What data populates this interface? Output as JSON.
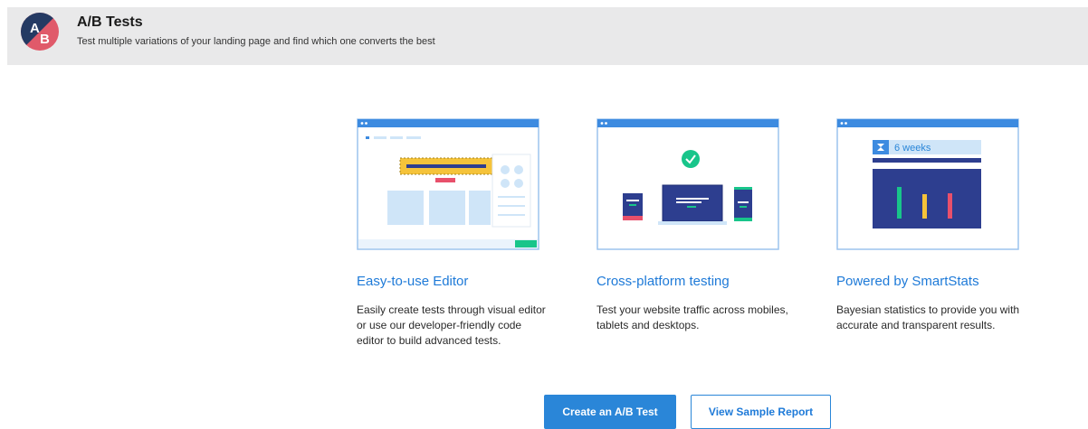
{
  "header": {
    "title": "A/B Tests",
    "subtitle": "Test multiple variations of your landing page and find which one converts the best",
    "logo_letters": {
      "a": "A",
      "b": "B"
    }
  },
  "features": [
    {
      "title": "Easy-to-use Editor",
      "description": "Easily create tests through visual editor or use our developer-friendly code editor to build advanced tests.",
      "illustration": "visual-editor-illustration"
    },
    {
      "title": "Cross-platform testing",
      "description": "Test your website traffic across mobiles, tablets and desktops.",
      "illustration": "devices-illustration"
    },
    {
      "title": "Powered by SmartStats",
      "description": "Bayesian statistics to provide you with accurate and transparent results.",
      "illustration": "smartstats-illustration",
      "duration_label": "6 weeks"
    }
  ],
  "actions": {
    "create_label": "Create an A/B Test",
    "sample_label": "View Sample Report"
  },
  "colors": {
    "accent": "#2a86d8",
    "link": "#1e7ad8",
    "header_bg": "#e9e9ea",
    "navy": "#2d3e8f",
    "green": "#18c58a",
    "red": "#e8506b",
    "yellow": "#f5c33a",
    "light_blue": "#cfe5f8"
  }
}
